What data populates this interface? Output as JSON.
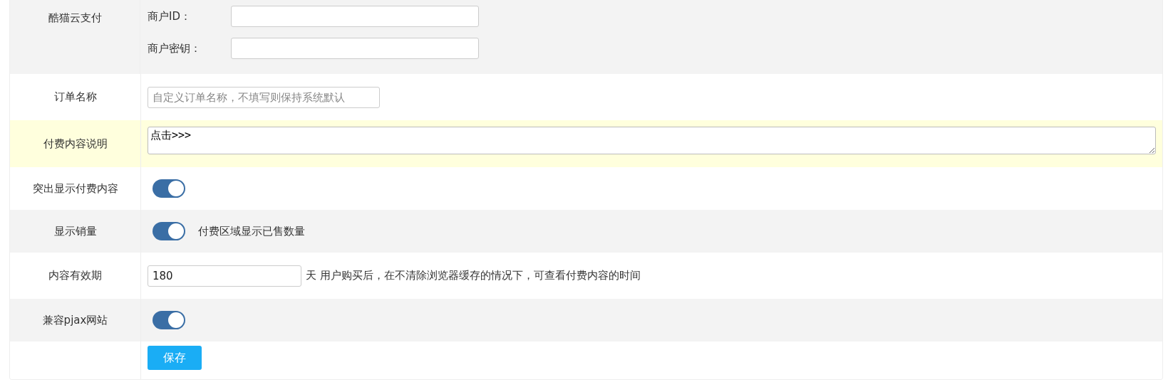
{
  "rows": [
    {
      "kind": "merchant",
      "label": "酷猫云支付",
      "highlighted": false,
      "fields": [
        {
          "label": "商户ID："
        },
        {
          "label": "商户密钥："
        }
      ]
    },
    {
      "kind": "text",
      "label": "订单名称",
      "highlighted": false,
      "placeholder": "自定义订单名称，不填写则保持系统默认"
    },
    {
      "kind": "textarea",
      "label": "付费内容说明",
      "highlighted": true,
      "value": "点击>>>"
    },
    {
      "kind": "switch",
      "label": "突出显示付费内容",
      "highlighted": false,
      "on": true
    },
    {
      "kind": "switch",
      "label": "显示销量",
      "highlighted": false,
      "on": true,
      "hint": "付费区域显示已售数量"
    },
    {
      "kind": "number",
      "label": "内容有效期",
      "highlighted": false,
      "value": "180",
      "hint": "天 用户购买后，在不清除浏览器缓存的情况下，可查看付费内容的时间"
    },
    {
      "kind": "switch",
      "label": "兼容pjax网站",
      "highlighted": false,
      "on": true
    },
    {
      "kind": "button",
      "highlighted": false,
      "button": "保存"
    }
  ]
}
